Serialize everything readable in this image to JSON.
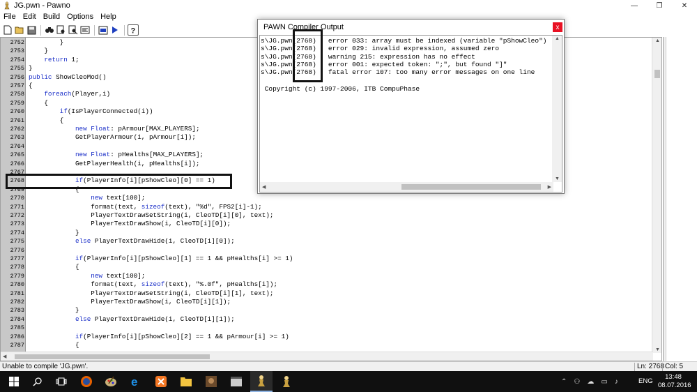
{
  "window": {
    "title": "JG.pwn - Pawno",
    "minimize": "—",
    "maximize": "❐",
    "close": "✕"
  },
  "menu": [
    "File",
    "Edit",
    "Build",
    "Options",
    "Help"
  ],
  "toolbar": {
    "buttons": [
      "new-file",
      "open-file",
      "save-file",
      "find",
      "find-replace",
      "find-next",
      "goto-line",
      "compile",
      "compile-run",
      "help"
    ]
  },
  "editor": {
    "lines": [
      {
        "num": "2752",
        "code": "        }"
      },
      {
        "num": "2753",
        "code": "    }"
      },
      {
        "num": "2754",
        "code": "    return 1;"
      },
      {
        "num": "2755",
        "code": "}"
      },
      {
        "num": "2756",
        "code": "public ShowCleoMod()"
      },
      {
        "num": "2757",
        "code": "{"
      },
      {
        "num": "2758",
        "code": "    foreach(Player,i)"
      },
      {
        "num": "2759",
        "code": "    {"
      },
      {
        "num": "2760",
        "code": "        if(IsPlayerConnected(i))"
      },
      {
        "num": "2761",
        "code": "        {"
      },
      {
        "num": "2762",
        "code": "            new Float: pArmour[MAX_PLAYERS];"
      },
      {
        "num": "2763",
        "code": "            GetPlayerArmour(i, pArmour[i]);"
      },
      {
        "num": "2764",
        "code": ""
      },
      {
        "num": "2765",
        "code": "            new Float: pHealths[MAX_PLAYERS];"
      },
      {
        "num": "2766",
        "code": "            GetPlayerHealth(i, pHealths[i]);"
      },
      {
        "num": "2767",
        "code": ""
      },
      {
        "num": "2768",
        "code": "            if(PlayerInfo[i][pShowCleo][0] == 1)"
      },
      {
        "num": "2769",
        "code": "            {"
      },
      {
        "num": "2770",
        "code": "                new text[100];"
      },
      {
        "num": "2771",
        "code": "                format(text, sizeof(text), \"%d\", FPS2[i]-1);"
      },
      {
        "num": "2772",
        "code": "                PlayerTextDrawSetString(i, CleoTD[i][0], text);"
      },
      {
        "num": "2773",
        "code": "                PlayerTextDrawShow(i, CleoTD[i][0]);"
      },
      {
        "num": "2774",
        "code": "            }"
      },
      {
        "num": "2775",
        "code": "            else PlayerTextDrawHide(i, CleoTD[i][0]);"
      },
      {
        "num": "2776",
        "code": ""
      },
      {
        "num": "2777",
        "code": "            if(PlayerInfo[i][pShowCleo][1] == 1 && pHealths[i] >= 1)"
      },
      {
        "num": "2778",
        "code": "            {"
      },
      {
        "num": "2779",
        "code": "                new text[100];"
      },
      {
        "num": "2780",
        "code": "                format(text, sizeof(text), \"%.0f\", pHealths[i]);"
      },
      {
        "num": "2781",
        "code": "                PlayerTextDrawSetString(i, CleoTD[i][1], text);"
      },
      {
        "num": "2782",
        "code": "                PlayerTextDrawShow(i, CleoTD[i][1]);"
      },
      {
        "num": "2783",
        "code": "            }"
      },
      {
        "num": "2784",
        "code": "            else PlayerTextDrawHide(i, CleoTD[i][1]);"
      },
      {
        "num": "2785",
        "code": ""
      },
      {
        "num": "2786",
        "code": "            if(PlayerInfo[i][pShowCleo][2] == 1 && pArmour[i] >= 1)"
      },
      {
        "num": "2787",
        "code": "            {"
      }
    ]
  },
  "compiler": {
    "title": "PAWN Compiler Output",
    "close": "x",
    "lines": [
      "s\\JG.pwn(2768) : error 033: array must be indexed (variable \"pShowCleo\")",
      "s\\JG.pwn(2768) : error 029: invalid expression, assumed zero",
      "s\\JG.pwn(2768) : warning 215: expression has no effect",
      "s\\JG.pwn(2768) : error 001: expected token: \";\", but found \"]\"",
      "s\\JG.pwn(2768) : fatal error 107: too many error messages on one line",
      "",
      " Copyright (c) 1997-2006, ITB CompuPhase"
    ]
  },
  "status": {
    "message": "Unable to compile 'JG.pwn'.",
    "line": "Ln: 2768",
    "col": "Col: 5"
  },
  "taskbar": {
    "language": "ENG",
    "time": "13:48",
    "date": "08.07.2016"
  }
}
